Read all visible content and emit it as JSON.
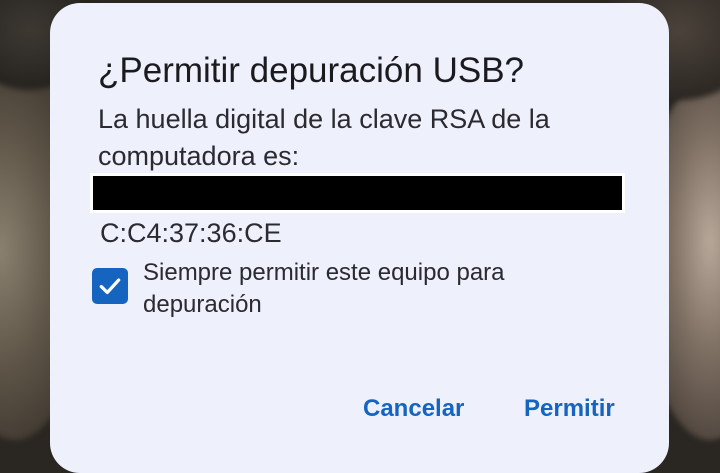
{
  "dialog": {
    "title": "¿Permitir depuración USB?",
    "message": "La huella digital de la clave RSA de la computadora es:",
    "fingerprint_visible_tail": "C:C4:37:36:CE",
    "checkbox": {
      "label": "Siempre permitir este equipo para depuración",
      "checked": true
    },
    "buttons": {
      "cancel": "Cancelar",
      "allow": "Permitir"
    }
  },
  "colors": {
    "dialog_background": "#eef0fb",
    "accent": "#1565c0",
    "text_primary": "#1b1b1f"
  }
}
